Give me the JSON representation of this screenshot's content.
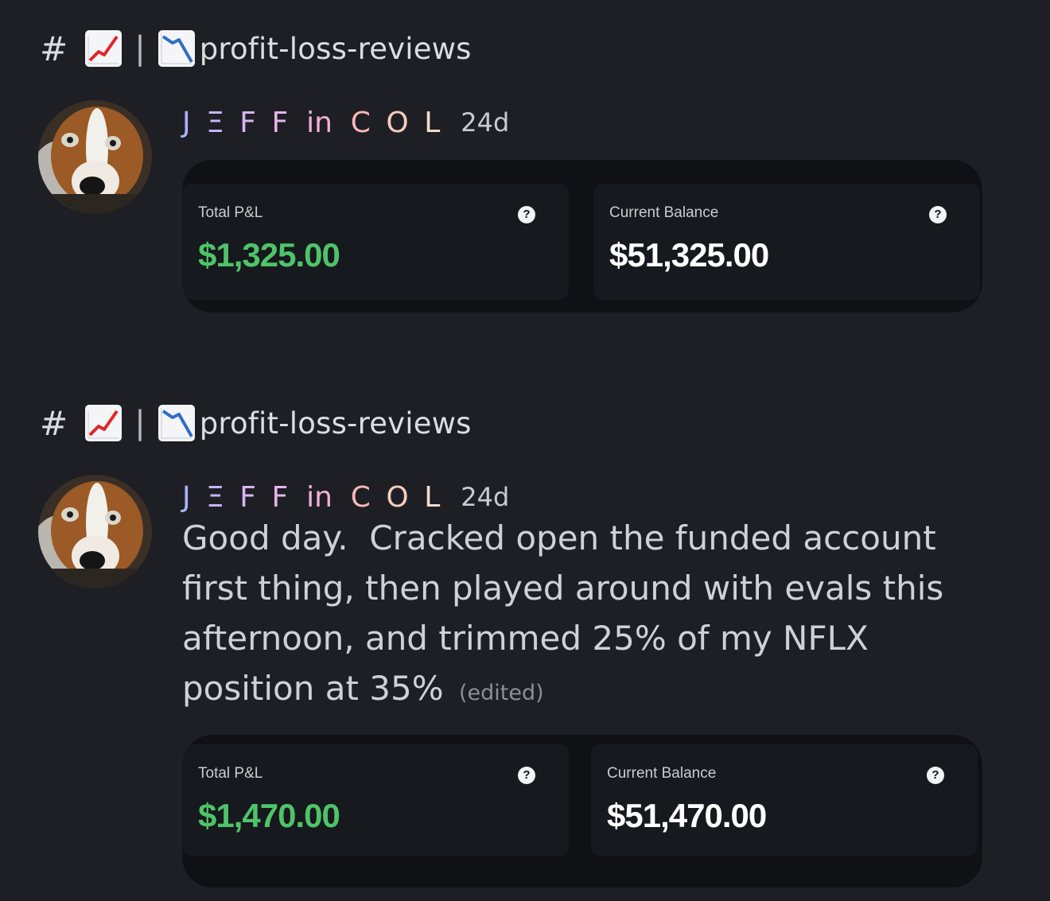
{
  "posts": [
    {
      "channel": {
        "hash": "#",
        "separator": "|",
        "name": "profit-loss-reviews",
        "icon1": "chart-increasing-icon",
        "icon2": "chart-decreasing-icon"
      },
      "author": {
        "name_chars": [
          "J",
          "Ξ",
          "F",
          "F",
          " in ",
          "C",
          "O",
          "L"
        ],
        "timestamp": "24d"
      },
      "message": {
        "text": "",
        "edited": ""
      },
      "stats": {
        "pnl_label": "Total P&L",
        "pnl_value": "$1,325.00",
        "balance_label": "Current Balance",
        "balance_value": "$51,325.00",
        "help": "?"
      }
    },
    {
      "channel": {
        "hash": "#",
        "separator": "|",
        "name": "profit-loss-reviews",
        "icon1": "chart-increasing-icon",
        "icon2": "chart-decreasing-icon"
      },
      "author": {
        "name_chars": [
          "J",
          "Ξ",
          "F",
          "F",
          " in ",
          "C",
          "O",
          "L"
        ],
        "timestamp": "24d"
      },
      "message": {
        "text": "Good day.  Cracked open the funded account first thing, then played around with evals this afternoon, and trimmed 25% of my NFLX position at 35%",
        "edited": "(edited)"
      },
      "stats": {
        "pnl_label": "Total P&L",
        "pnl_value": "$1,470.00",
        "balance_label": "Current Balance",
        "balance_value": "$51,470.00",
        "help": "?"
      }
    }
  ],
  "colors": {
    "background": "#1e1f24",
    "pnl_green": "#4fc36a",
    "balance_white": "#ffffff",
    "name_gradient": [
      "#a9b4ff",
      "#c6b4ff",
      "#d8b4f5",
      "#e9b2ea",
      "#f3b0d8",
      "#f8b7b7",
      "#f6cbbf",
      "#f2dccc"
    ]
  }
}
